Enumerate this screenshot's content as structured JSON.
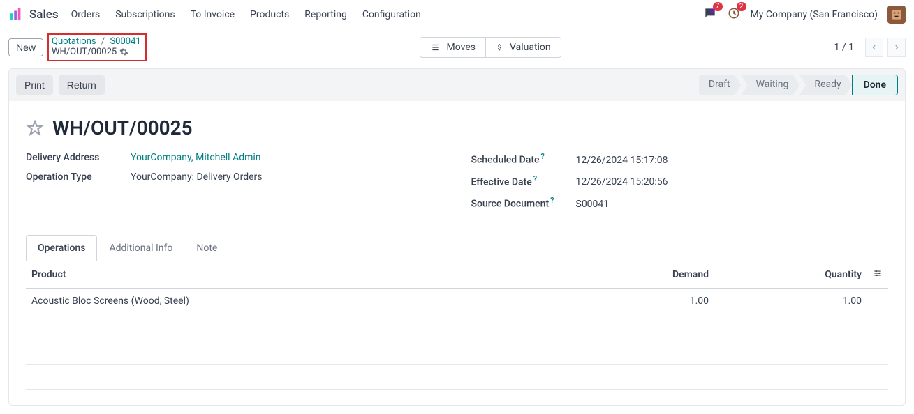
{
  "topbar": {
    "app": "Sales",
    "menu": [
      "Orders",
      "Subscriptions",
      "To Invoice",
      "Products",
      "Reporting",
      "Configuration"
    ],
    "chat_badge": "7",
    "activity_badge": "2",
    "company": "My Company (San Francisco)"
  },
  "subbar": {
    "new_label": "New",
    "crumb_root": "Quotations",
    "crumb_order": "S00041",
    "crumb_doc": "WH/OUT/00025",
    "moves_label": "Moves",
    "valuation_label": "Valuation",
    "pager": "1 / 1"
  },
  "actions": {
    "print": "Print",
    "return": "Return",
    "statuses": [
      "Draft",
      "Waiting",
      "Ready",
      "Done"
    ],
    "active_status_index": 3
  },
  "record": {
    "title": "WH/OUT/00025",
    "left": {
      "delivery_address_label": "Delivery Address",
      "delivery_address_value": "YourCompany, Mitchell Admin",
      "operation_type_label": "Operation Type",
      "operation_type_value": "YourCompany: Delivery Orders"
    },
    "right": {
      "scheduled_label": "Scheduled Date",
      "scheduled_value": "12/26/2024 15:17:08",
      "effective_label": "Effective Date",
      "effective_value": "12/26/2024 15:20:56",
      "source_label": "Source Document",
      "source_value": "S00041"
    }
  },
  "tabs": {
    "items": [
      "Operations",
      "Additional Info",
      "Note"
    ],
    "active": 0
  },
  "table": {
    "headers": {
      "product": "Product",
      "demand": "Demand",
      "quantity": "Quantity"
    },
    "rows": [
      {
        "product": "Acoustic Bloc Screens (Wood, Steel)",
        "demand": "1.00",
        "quantity": "1.00"
      }
    ]
  }
}
